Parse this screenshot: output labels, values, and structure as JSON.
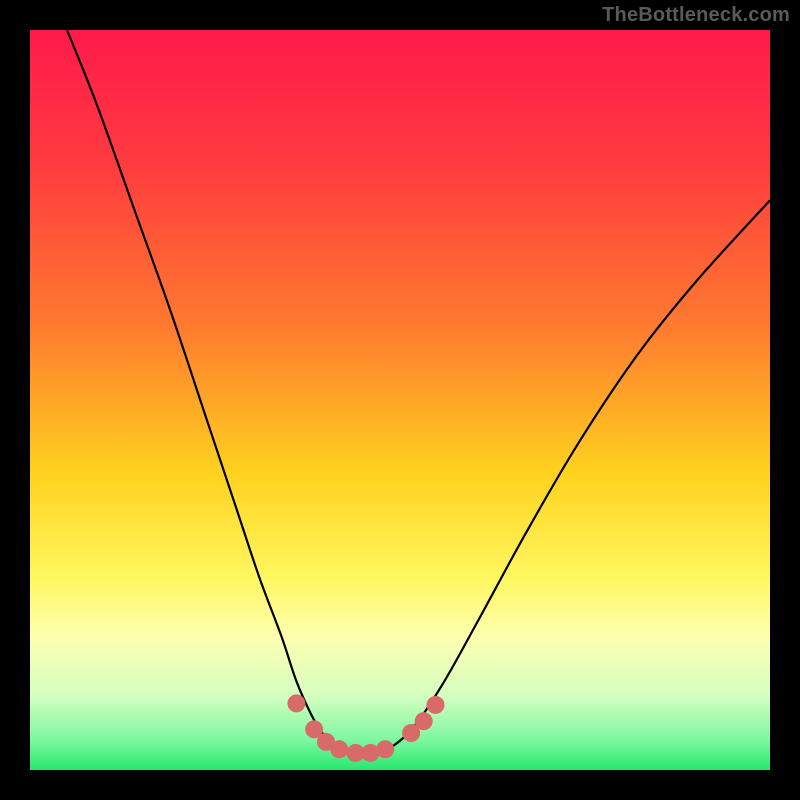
{
  "watermark": "TheBottleneck.com",
  "chart_data": {
    "type": "line",
    "title": "",
    "xlabel": "",
    "ylabel": "",
    "xlim": [
      0,
      1
    ],
    "ylim": [
      0,
      1
    ],
    "gradient_stops": [
      {
        "offset": 0.0,
        "color": "#ff1a4b"
      },
      {
        "offset": 0.18,
        "color": "#ff3b3f"
      },
      {
        "offset": 0.4,
        "color": "#ff7a2f"
      },
      {
        "offset": 0.6,
        "color": "#ffd21f"
      },
      {
        "offset": 0.74,
        "color": "#fff760"
      },
      {
        "offset": 0.82,
        "color": "#feffb0"
      },
      {
        "offset": 0.9,
        "color": "#d4ffc0"
      },
      {
        "offset": 0.96,
        "color": "#7cf7a0"
      },
      {
        "offset": 1.0,
        "color": "#27e86f"
      }
    ],
    "series": [
      {
        "name": "bottleneck-curve",
        "x": [
          0.05,
          0.09,
          0.14,
          0.19,
          0.24,
          0.28,
          0.31,
          0.34,
          0.36,
          0.38,
          0.395,
          0.41,
          0.43,
          0.45,
          0.47,
          0.49,
          0.52,
          0.56,
          0.61,
          0.67,
          0.74,
          0.82,
          0.9,
          1.0
        ],
        "values": [
          1.0,
          0.9,
          0.76,
          0.62,
          0.47,
          0.35,
          0.26,
          0.18,
          0.12,
          0.075,
          0.05,
          0.035,
          0.025,
          0.022,
          0.024,
          0.032,
          0.06,
          0.12,
          0.21,
          0.32,
          0.44,
          0.56,
          0.66,
          0.77
        ]
      }
    ],
    "markers": {
      "name": "highlight-dots",
      "color": "#d86a6a",
      "points": [
        {
          "x": 0.36,
          "y": 0.09
        },
        {
          "x": 0.384,
          "y": 0.055
        },
        {
          "x": 0.4,
          "y": 0.038
        },
        {
          "x": 0.418,
          "y": 0.028
        },
        {
          "x": 0.44,
          "y": 0.023
        },
        {
          "x": 0.46,
          "y": 0.023
        },
        {
          "x": 0.48,
          "y": 0.028
        },
        {
          "x": 0.515,
          "y": 0.05
        },
        {
          "x": 0.532,
          "y": 0.066
        },
        {
          "x": 0.548,
          "y": 0.088
        }
      ]
    }
  }
}
